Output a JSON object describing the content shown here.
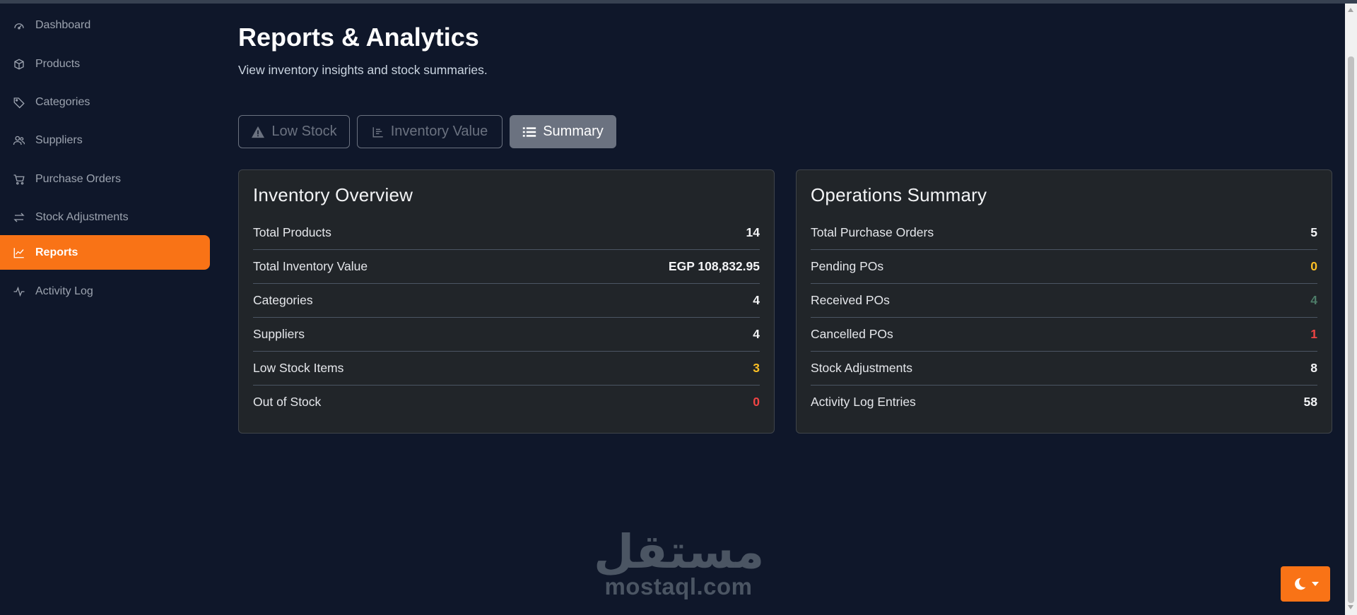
{
  "sidebar": {
    "items": [
      {
        "label": "Dashboard",
        "icon": "dashboard-icon"
      },
      {
        "label": "Products",
        "icon": "box-icon"
      },
      {
        "label": "Categories",
        "icon": "tag-icon"
      },
      {
        "label": "Suppliers",
        "icon": "users-icon"
      },
      {
        "label": "Purchase Orders",
        "icon": "cart-icon"
      },
      {
        "label": "Stock Adjustments",
        "icon": "arrows-exchange-icon"
      },
      {
        "label": "Reports",
        "icon": "line-chart-icon",
        "active": true
      },
      {
        "label": "Activity Log",
        "icon": "activity-icon"
      }
    ]
  },
  "page": {
    "title": "Reports & Analytics",
    "subtitle": "View inventory insights and stock summaries."
  },
  "tabs": [
    {
      "label": "Low Stock",
      "icon": "warning-icon"
    },
    {
      "label": "Inventory Value",
      "icon": "bar-chart-icon"
    },
    {
      "label": "Summary",
      "icon": "list-icon",
      "active": true
    }
  ],
  "inventory_overview": {
    "title": "Inventory Overview",
    "rows": [
      {
        "label": "Total Products",
        "value": "14"
      },
      {
        "label": "Total Inventory Value",
        "value": "EGP 108,832.95"
      },
      {
        "label": "Categories",
        "value": "4"
      },
      {
        "label": "Suppliers",
        "value": "4"
      },
      {
        "label": "Low Stock Items",
        "value": "3",
        "status": "warning"
      },
      {
        "label": "Out of Stock",
        "value": "0",
        "status": "danger"
      }
    ]
  },
  "operations_summary": {
    "title": "Operations Summary",
    "rows": [
      {
        "label": "Total Purchase Orders",
        "value": "5"
      },
      {
        "label": "Pending POs",
        "value": "0",
        "status": "warning"
      },
      {
        "label": "Received POs",
        "value": "4",
        "status": "success"
      },
      {
        "label": "Cancelled POs",
        "value": "1",
        "status": "danger"
      },
      {
        "label": "Stock Adjustments",
        "value": "8"
      },
      {
        "label": "Activity Log Entries",
        "value": "58"
      }
    ]
  },
  "watermark": {
    "arabic": "مستقل",
    "latin": "mostaql.com"
  },
  "colors": {
    "background": "#0f172a",
    "accent": "#f97316",
    "card": "#212529",
    "warning": "#fbbf24",
    "danger": "#ef4444",
    "success": "#4d7c68"
  }
}
